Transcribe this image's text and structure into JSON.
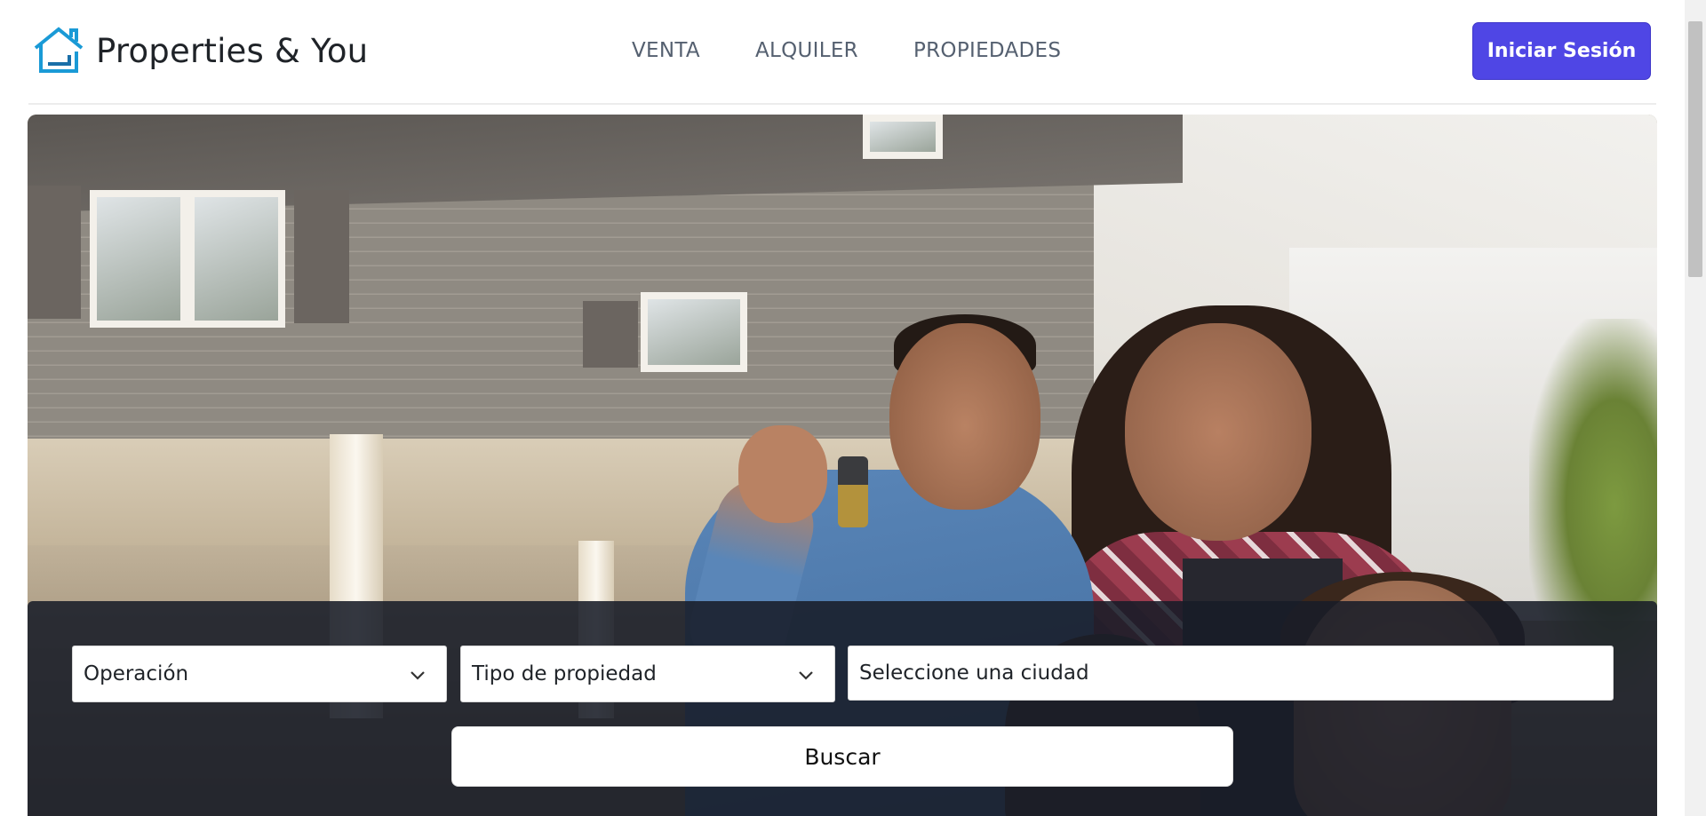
{
  "brand": {
    "name": "Properties & You",
    "logo_icon": "house-outline-icon",
    "accent": "#1a9ad6"
  },
  "nav": {
    "items": [
      {
        "label": "VENTA"
      },
      {
        "label": "ALQUILER"
      },
      {
        "label": "PROPIEDADES"
      }
    ]
  },
  "header": {
    "login_label": "Iniciar Sesión",
    "login_color": "#4f46e5"
  },
  "hero": {
    "image": "family-holding-house-keys-photo"
  },
  "search": {
    "operation": {
      "value": "Operación",
      "icon": "chevron-down-icon"
    },
    "property_type": {
      "value": "Tipo de propiedad",
      "icon": "chevron-down-icon"
    },
    "city": {
      "placeholder": "Seleccione una ciudad",
      "value": ""
    },
    "submit_label": "Buscar"
  }
}
